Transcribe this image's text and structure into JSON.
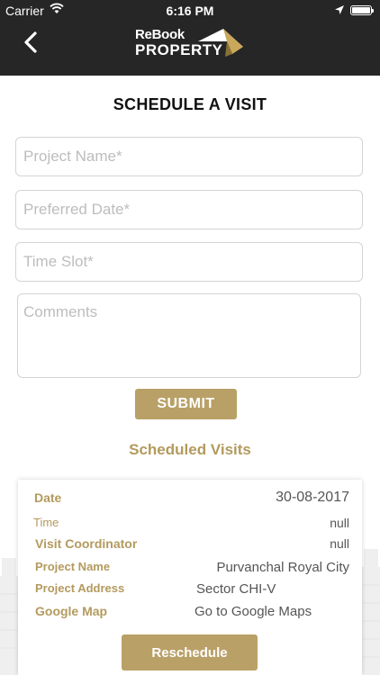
{
  "status_bar": {
    "carrier": "Carrier",
    "time": "6:16 PM"
  },
  "nav": {
    "logo_line1": "ReBook",
    "logo_line2": "PROPERTY"
  },
  "page_title": "SCHEDULE A VISIT",
  "form": {
    "project_name_placeholder": "Project Name*",
    "preferred_date_placeholder": "Preferred Date*",
    "time_slot_placeholder": "Time Slot*",
    "comments_placeholder": "Comments",
    "submit_label": "SUBMIT"
  },
  "scheduled_title": "Scheduled Visits",
  "visit": {
    "date_label": "Date",
    "date_value": "30-08-2017",
    "time_label": "Time",
    "time_value": "null",
    "coordinator_label": "Visit Coordinator",
    "coordinator_value": "null",
    "project_name_label": "Project Name",
    "project_name_value": "Purvanchal Royal City",
    "project_address_label": "Project Address",
    "project_address_value": "Sector CHI-V",
    "google_map_label": "Google Map",
    "google_map_value": "Go to Google Maps",
    "reschedule_label": "Reschedule"
  },
  "colors": {
    "accent": "#b9a067",
    "topbar": "#262626"
  },
  "icons": [
    "wifi-icon",
    "location-arrow-icon",
    "battery-icon",
    "back-chevron-icon",
    "logo-roof-icon"
  ]
}
